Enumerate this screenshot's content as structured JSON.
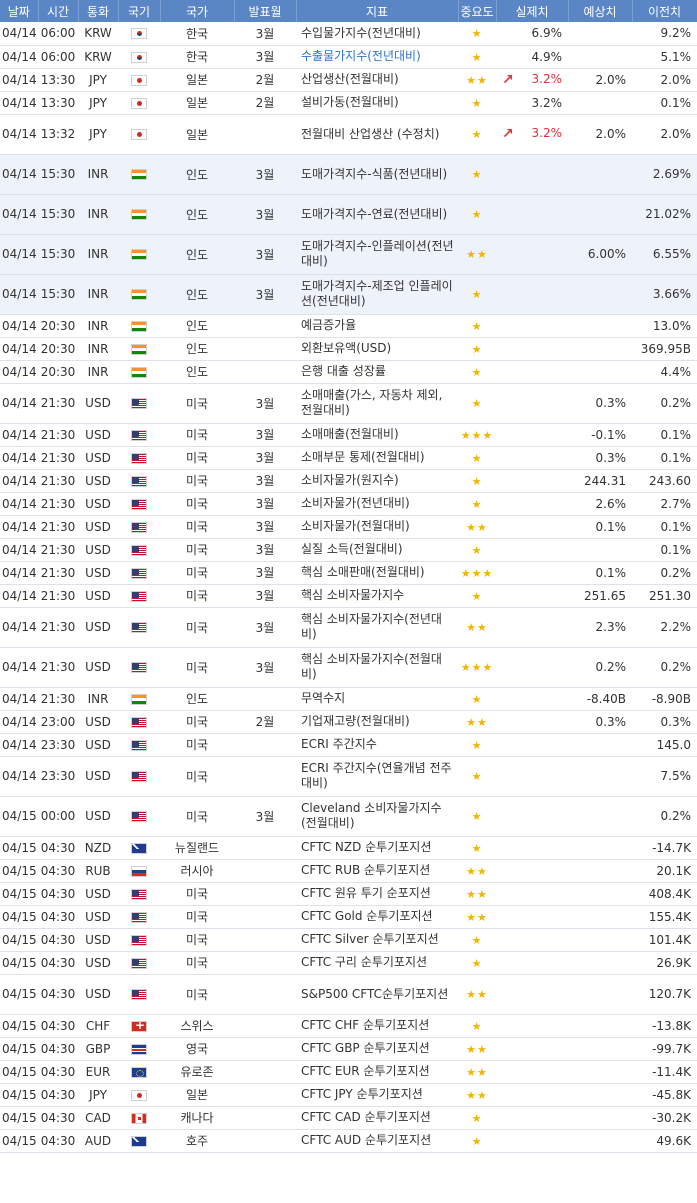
{
  "headers": [
    "날짜",
    "시간",
    "통화",
    "국기",
    "국가",
    "발표월",
    "지표",
    "중요도",
    "실제치",
    "예상치",
    "이전치"
  ],
  "rows": [
    {
      "date": "04/14",
      "time": "06:00",
      "cur": "KRW",
      "flag": "kr",
      "country": "한국",
      "month": "3월",
      "ind": "수입물가지수(전년대비)",
      "imp": "★",
      "act": "6.9%",
      "fc": "",
      "prev": "9.2%"
    },
    {
      "date": "04/14",
      "time": "06:00",
      "cur": "KRW",
      "flag": "kr",
      "country": "한국",
      "month": "3월",
      "ind": "수출물가지수(전년대비)",
      "imp": "★",
      "act": "4.9%",
      "fc": "",
      "prev": "5.1%",
      "blue": true
    },
    {
      "date": "04/14",
      "time": "13:30",
      "cur": "JPY",
      "flag": "jp",
      "country": "일본",
      "month": "2월",
      "ind": "산업생산(전월대비)",
      "imp": "★★",
      "act": "3.2%",
      "fc": "2.0%",
      "prev": "2.0%",
      "up": true
    },
    {
      "date": "04/14",
      "time": "13:30",
      "cur": "JPY",
      "flag": "jp",
      "country": "일본",
      "month": "2월",
      "ind": "설비가동(전월대비)",
      "imp": "★",
      "act": "3.2%",
      "fc": "",
      "prev": "0.1%"
    },
    {
      "date": "04/14",
      "time": "13:32",
      "cur": "JPY",
      "flag": "jp",
      "country": "일본",
      "month": "",
      "ind": "전월대비 산업생산 (수정치)",
      "imp": "★",
      "act": "3.2%",
      "fc": "2.0%",
      "prev": "2.0%",
      "up": true,
      "tall": true
    },
    {
      "date": "04/14",
      "time": "15:30",
      "cur": "INR",
      "flag": "in",
      "country": "인도",
      "month": "3월",
      "ind": "도매가격지수-식품(전년대비)",
      "imp": "★",
      "act": "",
      "fc": "",
      "prev": "2.69%",
      "tall": true,
      "hl": true
    },
    {
      "date": "04/14",
      "time": "15:30",
      "cur": "INR",
      "flag": "in",
      "country": "인도",
      "month": "3월",
      "ind": "도매가격지수-연료(전년대비)",
      "imp": "★",
      "act": "",
      "fc": "",
      "prev": "21.02%",
      "tall": true,
      "hl": true
    },
    {
      "date": "04/14",
      "time": "15:30",
      "cur": "INR",
      "flag": "in",
      "country": "인도",
      "month": "3월",
      "ind": "도매가격지수-인플레이션(전년대비)",
      "imp": "★★",
      "act": "",
      "fc": "6.00%",
      "prev": "6.55%",
      "tall": true,
      "hl": true
    },
    {
      "date": "04/14",
      "time": "15:30",
      "cur": "INR",
      "flag": "in",
      "country": "인도",
      "month": "3월",
      "ind": "도매가격지수-제조업 인플레이션(전년대비)",
      "imp": "★",
      "act": "",
      "fc": "",
      "prev": "3.66%",
      "tall": true,
      "hl": true
    },
    {
      "date": "04/14",
      "time": "20:30",
      "cur": "INR",
      "flag": "in",
      "country": "인도",
      "month": "",
      "ind": "예금증가율",
      "imp": "★",
      "act": "",
      "fc": "",
      "prev": "13.0%"
    },
    {
      "date": "04/14",
      "time": "20:30",
      "cur": "INR",
      "flag": "in",
      "country": "인도",
      "month": "",
      "ind": "외환보유액(USD)",
      "imp": "★",
      "act": "",
      "fc": "",
      "prev": "369.95B"
    },
    {
      "date": "04/14",
      "time": "20:30",
      "cur": "INR",
      "flag": "in",
      "country": "인도",
      "month": "",
      "ind": "은행 대출 성장률",
      "imp": "★",
      "act": "",
      "fc": "",
      "prev": "4.4%"
    },
    {
      "date": "04/14",
      "time": "21:30",
      "cur": "USD",
      "flag": "us",
      "country": "미국",
      "month": "3월",
      "ind": "소매매출(가스, 자동차 제외, 전월대비)",
      "imp": "★",
      "act": "",
      "fc": "0.3%",
      "prev": "0.2%",
      "tall": true
    },
    {
      "date": "04/14",
      "time": "21:30",
      "cur": "USD",
      "flag": "us",
      "country": "미국",
      "month": "3월",
      "ind": "소매매출(전월대비)",
      "imp": "★★★",
      "act": "",
      "fc": "-0.1%",
      "prev": "0.1%"
    },
    {
      "date": "04/14",
      "time": "21:30",
      "cur": "USD",
      "flag": "us",
      "country": "미국",
      "month": "3월",
      "ind": "소매부문 통제(전월대비)",
      "imp": "★",
      "act": "",
      "fc": "0.3%",
      "prev": "0.1%"
    },
    {
      "date": "04/14",
      "time": "21:30",
      "cur": "USD",
      "flag": "us",
      "country": "미국",
      "month": "3월",
      "ind": "소비자물가(원지수)",
      "imp": "★",
      "act": "",
      "fc": "244.31",
      "prev": "243.60"
    },
    {
      "date": "04/14",
      "time": "21:30",
      "cur": "USD",
      "flag": "us",
      "country": "미국",
      "month": "3월",
      "ind": "소비자물가(전년대비)",
      "imp": "★",
      "act": "",
      "fc": "2.6%",
      "prev": "2.7%"
    },
    {
      "date": "04/14",
      "time": "21:30",
      "cur": "USD",
      "flag": "us",
      "country": "미국",
      "month": "3월",
      "ind": "소비자물가(전월대비)",
      "imp": "★★",
      "act": "",
      "fc": "0.1%",
      "prev": "0.1%"
    },
    {
      "date": "04/14",
      "time": "21:30",
      "cur": "USD",
      "flag": "us",
      "country": "미국",
      "month": "3월",
      "ind": "실질 소득(전월대비)",
      "imp": "★",
      "act": "",
      "fc": "",
      "prev": "0.1%"
    },
    {
      "date": "04/14",
      "time": "21:30",
      "cur": "USD",
      "flag": "us",
      "country": "미국",
      "month": "3월",
      "ind": "핵심 소매판매(전월대비)",
      "imp": "★★★",
      "act": "",
      "fc": "0.1%",
      "prev": "0.2%"
    },
    {
      "date": "04/14",
      "time": "21:30",
      "cur": "USD",
      "flag": "us",
      "country": "미국",
      "month": "3월",
      "ind": "핵심 소비자물가지수",
      "imp": "★",
      "act": "",
      "fc": "251.65",
      "prev": "251.30"
    },
    {
      "date": "04/14",
      "time": "21:30",
      "cur": "USD",
      "flag": "us",
      "country": "미국",
      "month": "3월",
      "ind": "핵심 소비자물가지수(전년대비)",
      "imp": "★★",
      "act": "",
      "fc": "2.3%",
      "prev": "2.2%",
      "tall": true
    },
    {
      "date": "04/14",
      "time": "21:30",
      "cur": "USD",
      "flag": "us",
      "country": "미국",
      "month": "3월",
      "ind": "핵심 소비자물가지수(전월대비)",
      "imp": "★★★",
      "act": "",
      "fc": "0.2%",
      "prev": "0.2%",
      "tall": true
    },
    {
      "date": "04/14",
      "time": "21:30",
      "cur": "INR",
      "flag": "in",
      "country": "인도",
      "month": "",
      "ind": "무역수지",
      "imp": "★",
      "act": "",
      "fc": "-8.40B",
      "prev": "-8.90B"
    },
    {
      "date": "04/14",
      "time": "23:00",
      "cur": "USD",
      "flag": "us",
      "country": "미국",
      "month": "2월",
      "ind": "기업재고량(전월대비)",
      "imp": "★★",
      "act": "",
      "fc": "0.3%",
      "prev": "0.3%"
    },
    {
      "date": "04/14",
      "time": "23:30",
      "cur": "USD",
      "flag": "us",
      "country": "미국",
      "month": "",
      "ind": "ECRI 주간지수",
      "imp": "★",
      "act": "",
      "fc": "",
      "prev": "145.0"
    },
    {
      "date": "04/14",
      "time": "23:30",
      "cur": "USD",
      "flag": "us",
      "country": "미국",
      "month": "",
      "ind": "ECRI 주간지수(연율개념 전주대비)",
      "imp": "★",
      "act": "",
      "fc": "",
      "prev": "7.5%",
      "tall": true
    },
    {
      "date": "04/15",
      "time": "00:00",
      "cur": "USD",
      "flag": "us",
      "country": "미국",
      "month": "3월",
      "ind": "Cleveland 소비자물가지수(전월대비)",
      "imp": "★",
      "act": "",
      "fc": "",
      "prev": "0.2%",
      "tall": true
    },
    {
      "date": "04/15",
      "time": "04:30",
      "cur": "NZD",
      "flag": "nz",
      "country": "뉴질랜드",
      "month": "",
      "ind": "CFTC NZD 순투기포지션",
      "imp": "★",
      "act": "",
      "fc": "",
      "prev": "-14.7K"
    },
    {
      "date": "04/15",
      "time": "04:30",
      "cur": "RUB",
      "flag": "ru",
      "country": "러시아",
      "month": "",
      "ind": "CFTC RUB 순투기포지션",
      "imp": "★★",
      "act": "",
      "fc": "",
      "prev": "20.1K"
    },
    {
      "date": "04/15",
      "time": "04:30",
      "cur": "USD",
      "flag": "us",
      "country": "미국",
      "month": "",
      "ind": "CFTC 원유 투기 순포지션",
      "imp": "★★",
      "act": "",
      "fc": "",
      "prev": "408.4K"
    },
    {
      "date": "04/15",
      "time": "04:30",
      "cur": "USD",
      "flag": "us",
      "country": "미국",
      "month": "",
      "ind": "CFTC Gold 순투기포지션",
      "imp": "★★",
      "act": "",
      "fc": "",
      "prev": "155.4K"
    },
    {
      "date": "04/15",
      "time": "04:30",
      "cur": "USD",
      "flag": "us",
      "country": "미국",
      "month": "",
      "ind": "CFTC Silver 순투기포지션",
      "imp": "★",
      "act": "",
      "fc": "",
      "prev": "101.4K"
    },
    {
      "date": "04/15",
      "time": "04:30",
      "cur": "USD",
      "flag": "us",
      "country": "미국",
      "month": "",
      "ind": "CFTC 구리 순투기포지션",
      "imp": "★",
      "act": "",
      "fc": "",
      "prev": "26.9K"
    },
    {
      "date": "04/15",
      "time": "04:30",
      "cur": "USD",
      "flag": "us",
      "country": "미국",
      "month": "",
      "ind": "S&P500 CFTC순투기포지션",
      "imp": "★★",
      "act": "",
      "fc": "",
      "prev": "120.7K",
      "tall": true
    },
    {
      "date": "04/15",
      "time": "04:30",
      "cur": "CHF",
      "flag": "ch",
      "country": "스위스",
      "month": "",
      "ind": "CFTC CHF 순투기포지션",
      "imp": "★",
      "act": "",
      "fc": "",
      "prev": "-13.8K"
    },
    {
      "date": "04/15",
      "time": "04:30",
      "cur": "GBP",
      "flag": "gb",
      "country": "영국",
      "month": "",
      "ind": "CFTC GBP 순투기포지션",
      "imp": "★★",
      "act": "",
      "fc": "",
      "prev": "-99.7K"
    },
    {
      "date": "04/15",
      "time": "04:30",
      "cur": "EUR",
      "flag": "eu",
      "country": "유로존",
      "month": "",
      "ind": "CFTC EUR 순투기포지션",
      "imp": "★★",
      "act": "",
      "fc": "",
      "prev": "-11.4K"
    },
    {
      "date": "04/15",
      "time": "04:30",
      "cur": "JPY",
      "flag": "jp",
      "country": "일본",
      "month": "",
      "ind": "CFTC JPY 순투기포지션",
      "imp": "★★",
      "act": "",
      "fc": "",
      "prev": "-45.8K"
    },
    {
      "date": "04/15",
      "time": "04:30",
      "cur": "CAD",
      "flag": "ca",
      "country": "캐나다",
      "month": "",
      "ind": "CFTC CAD 순투기포지션",
      "imp": "★",
      "act": "",
      "fc": "",
      "prev": "-30.2K"
    },
    {
      "date": "04/15",
      "time": "04:30",
      "cur": "AUD",
      "flag": "au",
      "country": "호주",
      "month": "",
      "ind": "CFTC AUD 순투기포지션",
      "imp": "★",
      "act": "",
      "fc": "",
      "prev": "49.6K"
    }
  ]
}
